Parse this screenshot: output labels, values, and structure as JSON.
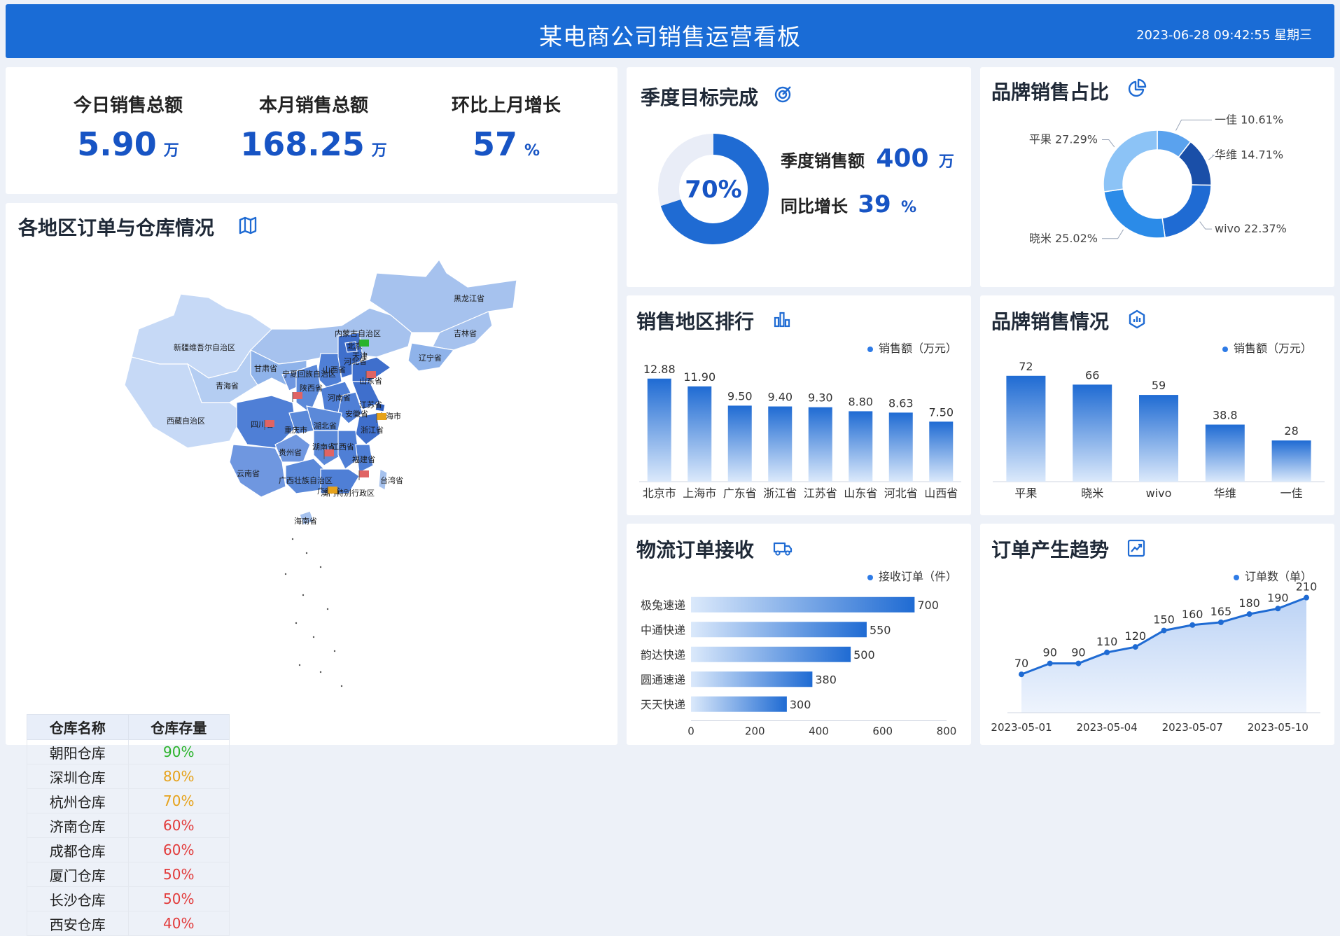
{
  "header": {
    "title": "某电商公司销售运营看板",
    "datetime": "2023-06-28 09:42:55 星期三"
  },
  "kpis": [
    {
      "label": "今日销售总额",
      "value": "5.90",
      "unit": "万"
    },
    {
      "label": "本月销售总额",
      "value": "168.25",
      "unit": "万"
    },
    {
      "label": "环比上月增长",
      "value": "57",
      "unit": "%"
    }
  ],
  "map_panel": {
    "title": "各地区订单与仓库情况",
    "regions": [
      "黑龙江省",
      "吉林省",
      "辽宁省",
      "内蒙古自治区",
      "新疆维吾尔自治区",
      "青海省",
      "西藏自治区",
      "甘肃省",
      "宁夏回族自治区",
      "山西省",
      "北京",
      "天津",
      "河北省",
      "山东省",
      "陕西省",
      "河南省",
      "江苏省",
      "安徽省",
      "上海市",
      "四川省",
      "重庆市",
      "湖北省",
      "浙江省",
      "贵州省",
      "湖南省",
      "江西省",
      "福建省",
      "云南省",
      "广西壮族自治区",
      "广东省",
      "台湾省",
      "澳门特别行政区",
      "海南省"
    ],
    "warehouse_table": {
      "headers": [
        "仓库名称",
        "仓库存量"
      ],
      "rows": [
        {
          "name": "朝阳仓库",
          "stock": "90%",
          "color": "#2ab32a"
        },
        {
          "name": "深圳仓库",
          "stock": "80%",
          "color": "#e6a21a"
        },
        {
          "name": "杭州仓库",
          "stock": "70%",
          "color": "#e6a21a"
        },
        {
          "name": "济南仓库",
          "stock": "60%",
          "color": "#e23b3b"
        },
        {
          "name": "成都仓库",
          "stock": "60%",
          "color": "#e23b3b"
        },
        {
          "name": "厦门仓库",
          "stock": "50%",
          "color": "#e23b3b"
        },
        {
          "name": "长沙仓库",
          "stock": "50%",
          "color": "#e23b3b"
        },
        {
          "name": "西安仓库",
          "stock": "40%",
          "color": "#e23b3b"
        }
      ]
    }
  },
  "quarter": {
    "title": "季度目标完成",
    "percent_label": "70%",
    "completion": 0.7,
    "sales_label": "季度销售额",
    "sales_value": "400",
    "sales_unit": "万",
    "growth_label": "同比增长",
    "growth_value": "39",
    "growth_unit": "%"
  },
  "brand_share": {
    "title": "品牌销售占比",
    "slices": [
      {
        "name": "一佳",
        "pct": 10.61,
        "label": "一佳 10.61%",
        "color": "#5aa2ee"
      },
      {
        "name": "华维",
        "pct": 14.71,
        "label": "华维 14.71%",
        "color": "#1a4fa8"
      },
      {
        "name": "wivo",
        "pct": 22.37,
        "label": "wivo 22.37%",
        "color": "#1f6bd3"
      },
      {
        "name": "晓米",
        "pct": 25.02,
        "label": "晓米 25.02%",
        "color": "#2b8be8"
      },
      {
        "name": "平果",
        "pct": 27.29,
        "label": "平果 27.29%",
        "color": "#8cc3f6"
      }
    ]
  },
  "region_rank": {
    "title": "销售地区排行",
    "legend": "销售额（万元）",
    "chart_data": {
      "type": "bar",
      "categories": [
        "北京市",
        "上海市",
        "广东省",
        "浙江省",
        "江苏省",
        "山东省",
        "河北省",
        "山西省"
      ],
      "values": [
        12.88,
        11.9,
        9.5,
        9.4,
        9.3,
        8.8,
        8.63,
        7.5
      ],
      "labels": [
        "12.88",
        "11.90",
        "9.50",
        "9.40",
        "9.30",
        "8.80",
        "8.63",
        "7.50"
      ],
      "ylim": [
        0,
        14
      ]
    }
  },
  "brand_sales": {
    "title": "品牌销售情况",
    "legend": "销售额（万元）",
    "chart_data": {
      "type": "bar",
      "categories": [
        "平果",
        "晓米",
        "wivo",
        "华维",
        "一佳"
      ],
      "values": [
        72,
        66,
        59,
        38.8,
        28
      ],
      "labels": [
        "72",
        "66",
        "59",
        "38.8",
        "28"
      ],
      "ylim": [
        0,
        80
      ]
    }
  },
  "logistics": {
    "title": "物流订单接收",
    "legend": "接收订单（件）",
    "chart_data": {
      "type": "bar",
      "orientation": "horizontal",
      "categories": [
        "极兔速递",
        "中通快递",
        "韵达快递",
        "圆通速递",
        "天天快递"
      ],
      "values": [
        700,
        550,
        500,
        380,
        300
      ],
      "labels": [
        "700",
        "550",
        "500",
        "380",
        "300"
      ],
      "xticks": [
        "0",
        "200",
        "400",
        "600",
        "800"
      ],
      "xlim": [
        0,
        800
      ]
    }
  },
  "trend": {
    "title": "订单产生趋势",
    "legend": "订单数（单）",
    "chart_data": {
      "type": "area",
      "x": [
        "2023-05-01",
        "2023-05-02",
        "2023-05-03",
        "2023-05-04",
        "2023-05-05",
        "2023-05-06",
        "2023-05-07",
        "2023-05-08",
        "2023-05-09",
        "2023-05-10",
        "2023-05-11"
      ],
      "values": [
        70,
        90,
        90,
        110,
        120,
        150,
        160,
        165,
        180,
        190,
        210
      ],
      "labels": [
        "70",
        "90",
        "90",
        "110",
        "120",
        "150",
        "160",
        "165",
        "180",
        "190",
        "210"
      ],
      "xticks": [
        "2023-05-01",
        "2023-05-04",
        "2023-05-07",
        "2023-05-10"
      ],
      "ylim": [
        0,
        230
      ]
    }
  }
}
